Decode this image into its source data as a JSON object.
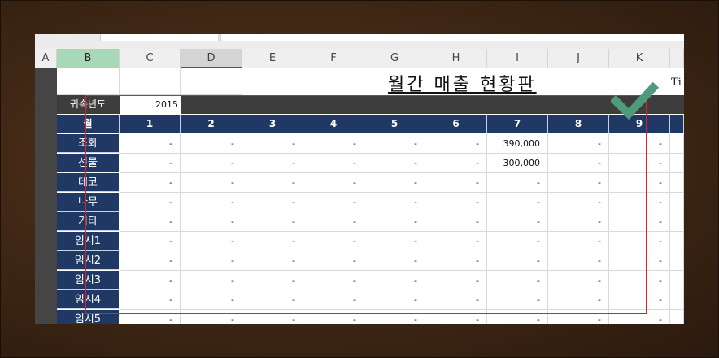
{
  "sheet": {
    "columns": [
      "A",
      "B",
      "C",
      "D",
      "E",
      "F",
      "G",
      "H",
      "I",
      "J",
      "K"
    ],
    "title": "월간 매출 현황판",
    "partial_text": "Ti",
    "year_label": "귀속년도",
    "year_value": "2015",
    "month_header_label": "월",
    "months": [
      "1",
      "2",
      "3",
      "4",
      "5",
      "6",
      "7",
      "8",
      "9"
    ],
    "rows": [
      {
        "label": "조화",
        "values": [
          "-",
          "-",
          "-",
          "-",
          "-",
          "-",
          "390,000",
          "-",
          "-"
        ]
      },
      {
        "label": "선물",
        "values": [
          "-",
          "-",
          "-",
          "-",
          "-",
          "-",
          "300,000",
          "-",
          "-"
        ]
      },
      {
        "label": "데코",
        "values": [
          "-",
          "-",
          "-",
          "-",
          "-",
          "-",
          "-",
          "-",
          "-"
        ]
      },
      {
        "label": "나무",
        "values": [
          "-",
          "-",
          "-",
          "-",
          "-",
          "-",
          "-",
          "-",
          "-"
        ]
      },
      {
        "label": "기타",
        "values": [
          "-",
          "-",
          "-",
          "-",
          "-",
          "-",
          "-",
          "-",
          "-"
        ]
      },
      {
        "label": "임시1",
        "values": [
          "-",
          "-",
          "-",
          "-",
          "-",
          "-",
          "-",
          "-",
          "-"
        ]
      },
      {
        "label": "임시2",
        "values": [
          "-",
          "-",
          "-",
          "-",
          "-",
          "-",
          "-",
          "-",
          "-"
        ]
      },
      {
        "label": "임시3",
        "values": [
          "-",
          "-",
          "-",
          "-",
          "-",
          "-",
          "-",
          "-",
          "-"
        ]
      },
      {
        "label": "임시4",
        "values": [
          "-",
          "-",
          "-",
          "-",
          "-",
          "-",
          "-",
          "-",
          "-"
        ]
      },
      {
        "label": "임시5",
        "values": [
          "-",
          "-",
          "-",
          "-",
          "-",
          "-",
          "-",
          "-",
          "-"
        ]
      }
    ]
  },
  "colors": {
    "header_navy": "#1f3864",
    "year_band": "#3d3d3d",
    "selected_col_b": "#a9d8b8",
    "highlight_box": "#e02030",
    "checkmark": "#4e9a7a"
  },
  "icons": {
    "checkmark": "checkmark-icon"
  }
}
